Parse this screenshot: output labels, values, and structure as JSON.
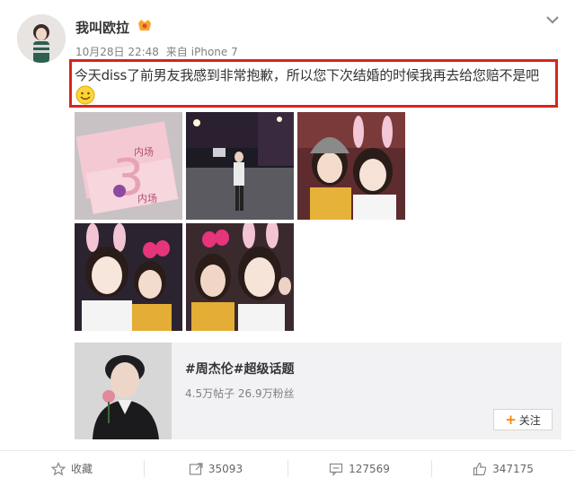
{
  "post": {
    "username": "我叫欧拉",
    "date": "10月28日 22:48",
    "source_prefix": "来自",
    "source": "iPhone 7",
    "text": "今天diss了前男友我感到非常抱歉，所以您下次结婚的时候我再去给您赔不是吧"
  },
  "photos": [
    {
      "name": "photo-tickets",
      "text_top": "内场",
      "text_mid": "3",
      "text_bottom": "内场"
    },
    {
      "name": "photo-stadium"
    },
    {
      "name": "photo-selfie-1"
    },
    {
      "name": "photo-selfie-2"
    },
    {
      "name": "photo-selfie-3"
    }
  ],
  "topic": {
    "title": "#周杰伦#超级话题",
    "stats": "4.5万帖子 26.9万粉丝",
    "follow_label": "关注"
  },
  "actions": {
    "favorite_label": "收藏",
    "repost_count": "35093",
    "comment_count": "127569",
    "like_count": "347175"
  },
  "colors": {
    "highlight_border": "#d9241c",
    "accent_orange": "#ff8200",
    "topic_bg": "#f2f2f5"
  }
}
